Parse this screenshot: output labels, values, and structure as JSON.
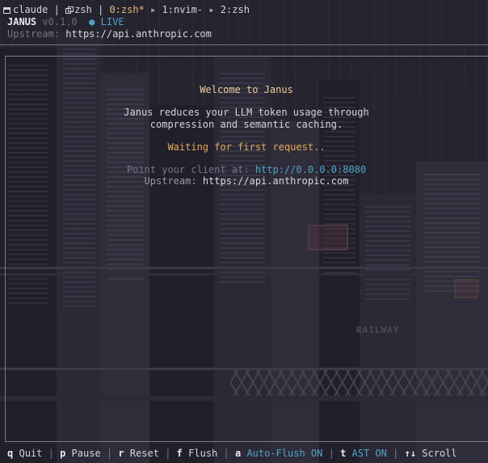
{
  "topbar": {
    "session": "claude",
    "sep1": "|",
    "shell": "zsh",
    "sep2": "|",
    "window0": "0:zsh*",
    "window1": "1:nvim-",
    "window2": "2:zsh",
    "tri_glyph": "▸",
    "icon_session": "terminal-icon",
    "icon_shell": "windows-icon"
  },
  "header": {
    "app_name": "JANUS",
    "version": "v0.1.0",
    "live_dot": "●",
    "live_label": "LIVE",
    "upstream_label": "Upstream:",
    "upstream_url": "https://api.anthropic.com"
  },
  "main": {
    "welcome": "Welcome to Janus",
    "desc_line1": "Janus reduces your LLM token usage through",
    "desc_line2": "compression and semantic caching.",
    "waiting": "Waiting for first request..",
    "point_label": "Point your client at:",
    "point_url": "http://0.0.0.0:8080",
    "upstream_label": "Upstream:",
    "upstream_url": "https://api.anthropic.com",
    "bg_sign_text": "RAILWAY"
  },
  "footer": {
    "items": [
      {
        "key": "q",
        "label": "Quit"
      },
      {
        "key": "p",
        "label": "Pause"
      },
      {
        "key": "r",
        "label": "Reset"
      },
      {
        "key": "f",
        "label": "Flush"
      },
      {
        "key": "a",
        "label": "Auto-Flush ON"
      },
      {
        "key": "t",
        "label": "AST ON"
      },
      {
        "key": "↑↓",
        "label": "Scroll"
      }
    ],
    "separator": "|"
  },
  "colors": {
    "background": "#22202b",
    "accent": "#4fa3c8",
    "warning": "#e3a85a",
    "active_window": "#e3b978"
  }
}
